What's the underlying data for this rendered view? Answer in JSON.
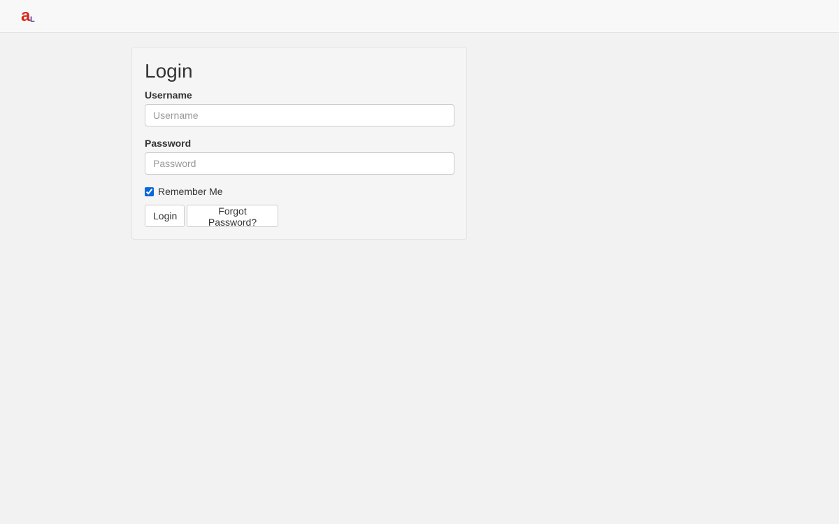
{
  "header": {
    "logo": {
      "icon": "al-logo-icon",
      "letter_primary": "a",
      "letter_secondary": "L",
      "color_primary": "#d9281e",
      "color_secondary": "#4a3fa8"
    }
  },
  "login": {
    "title": "Login",
    "username_label": "Username",
    "username_placeholder": "Username",
    "username_value": "",
    "password_label": "Password",
    "password_placeholder": "Password",
    "password_value": "",
    "remember_label": "Remember Me",
    "remember_checked": true,
    "login_button": "Login",
    "forgot_button": "Forgot Password?"
  }
}
